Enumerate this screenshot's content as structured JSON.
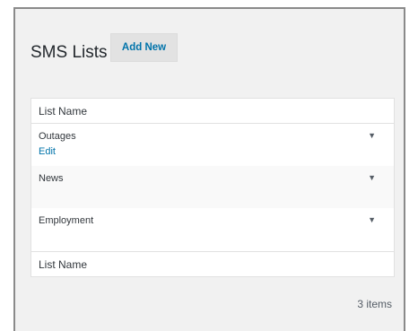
{
  "header": {
    "title": "SMS Lists",
    "add_new_label": "Add New"
  },
  "table": {
    "column_header": "List Name",
    "footer_header": "List Name",
    "rows": [
      {
        "name": "Outages",
        "edit_label": "Edit"
      },
      {
        "name": "News"
      },
      {
        "name": "Employment"
      }
    ],
    "toggle_glyph": "▼"
  },
  "pagination": {
    "items_count": "3 items"
  },
  "colors": {
    "link": "#0073aa",
    "panel_bg": "#f1f1f1",
    "border": "#8a8a8a"
  }
}
